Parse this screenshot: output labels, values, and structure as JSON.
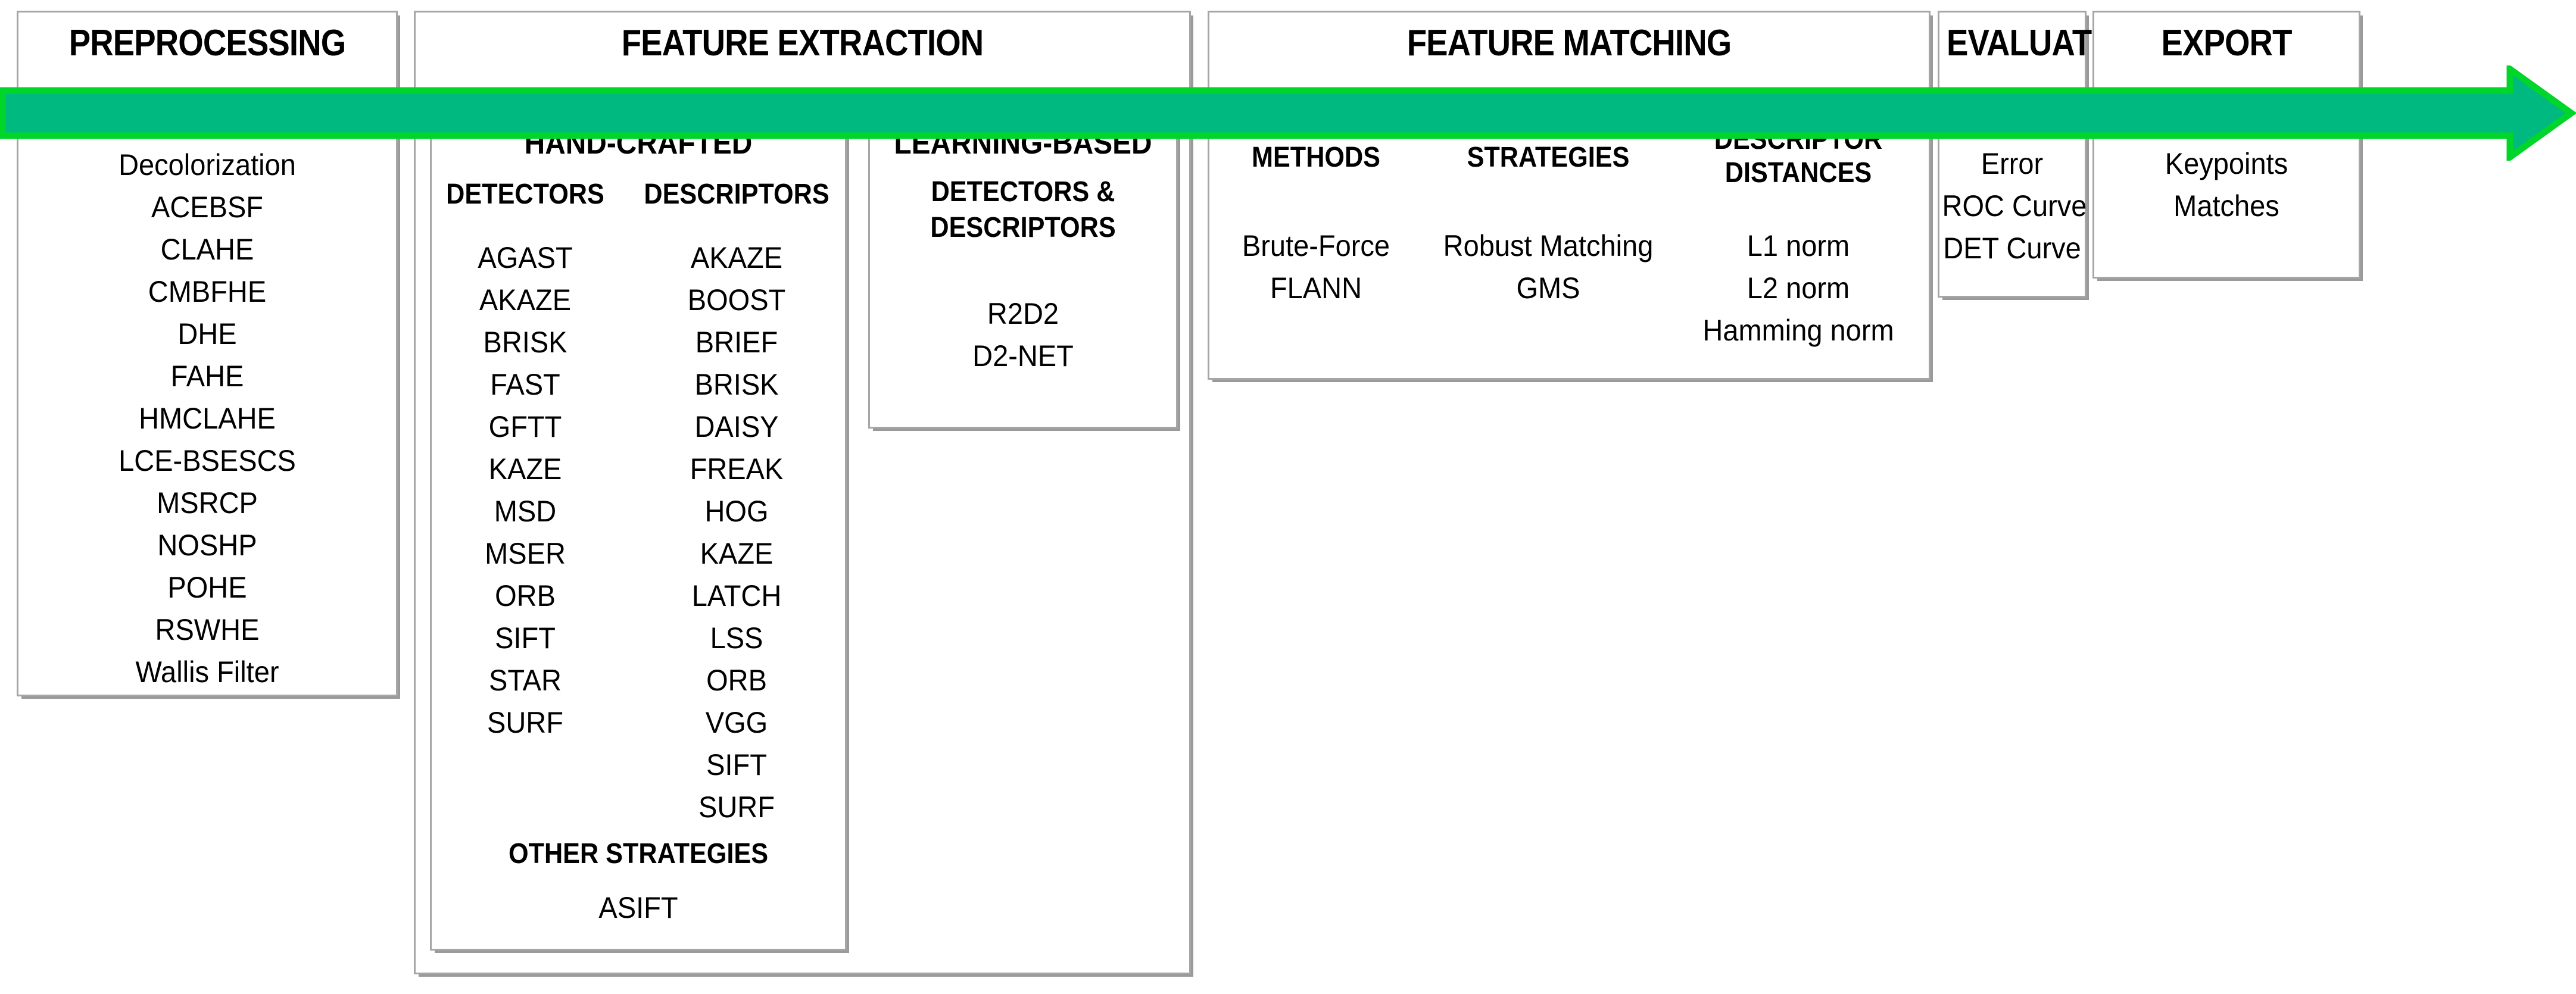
{
  "pipeline": {
    "arrow": {
      "label": "pipeline-flow-arrow",
      "fill_color": "#00B981",
      "stroke_color": "#00D62A"
    },
    "stages": [
      {
        "id": "preprocessing",
        "title": "PREPROCESSING",
        "items": [
          "Decolorization",
          "ACEBSF",
          "CLAHE",
          "CMBFHE",
          "DHE",
          "FAHE",
          "HMCLAHE",
          "LCE-BSESCS",
          "MSRCP",
          "NOSHP",
          "POHE",
          "RSWHE",
          "Wallis Filter"
        ]
      },
      {
        "id": "feature-extraction",
        "title": "FEATURE EXTRACTION",
        "subgroups": [
          {
            "id": "hand-crafted",
            "title": "HAND-CRAFTED",
            "columns": [
              {
                "id": "detectors",
                "header": "DETECTORS",
                "items": [
                  "AGAST",
                  "AKAZE",
                  "BRISK",
                  "FAST",
                  "GFTT",
                  "KAZE",
                  "MSD",
                  "MSER",
                  "ORB",
                  "SIFT",
                  "STAR",
                  "SURF"
                ]
              },
              {
                "id": "descriptors",
                "header": "DESCRIPTORS",
                "items": [
                  "AKAZE",
                  "BOOST",
                  "BRIEF",
                  "BRISK",
                  "DAISY",
                  "FREAK",
                  "HOG",
                  "KAZE",
                  "LATCH",
                  "LSS",
                  "ORB",
                  "VGG",
                  "SIFT",
                  "SURF"
                ]
              }
            ],
            "other": {
              "header": "OTHER STRATEGIES",
              "items": [
                "ASIFT"
              ]
            }
          },
          {
            "id": "learning-based",
            "title": "LEARNING-BASED",
            "subtitle_line1": "DETECTORS &",
            "subtitle_line2": "DESCRIPTORS",
            "items": [
              "R2D2",
              "D2-NET"
            ]
          }
        ]
      },
      {
        "id": "feature-matching",
        "title": "FEATURE MATCHING",
        "columns": [
          {
            "id": "methods",
            "header_line1": "METHODS",
            "header_line2": "",
            "items": [
              "Brute-Force",
              "FLANN"
            ]
          },
          {
            "id": "strategies",
            "header_line1": "STRATEGIES",
            "header_line2": "",
            "items": [
              "Robust Matching",
              "GMS"
            ]
          },
          {
            "id": "descriptor-distances",
            "header_line1": "DESCRIPTOR",
            "header_line2": "DISTANCES",
            "items": [
              "L1 norm",
              "L2 norm",
              "Hamming norm"
            ]
          }
        ]
      },
      {
        "id": "evaluation",
        "title": "EVALUATION",
        "items": [
          "Error",
          "ROC Curve",
          "DET Curve"
        ]
      },
      {
        "id": "export",
        "title": "EXPORT",
        "items": [
          "Keypoints",
          "Matches"
        ]
      }
    ]
  }
}
